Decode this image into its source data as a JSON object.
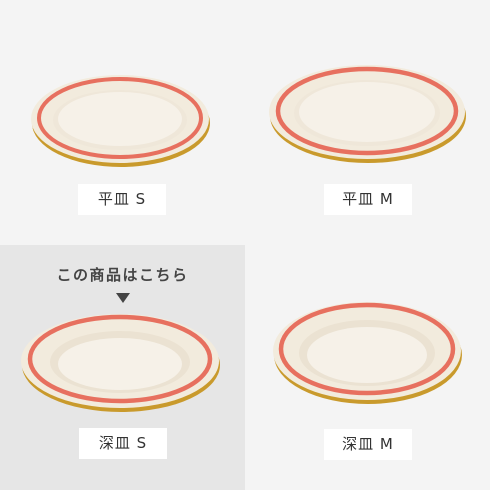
{
  "products": [
    {
      "label": "平皿 S"
    },
    {
      "label": "平皿 M"
    },
    {
      "label": "深皿 S"
    },
    {
      "label": "深皿 M"
    }
  ],
  "selected_note": "この商品はこちら",
  "selected_index": 2,
  "colors": {
    "rim_stripe": "#e7705f",
    "rim_gold": "#c99a2c",
    "plate_body": "#f3ece0",
    "selected_bg": "#e6e6e6",
    "page_bg": "#f4f4f4"
  },
  "icons": [
    "down-triangle-icon"
  ]
}
